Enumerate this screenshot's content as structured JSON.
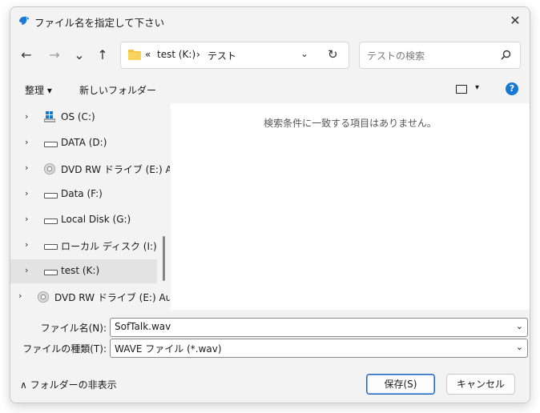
{
  "window": {
    "title": "ファイル名を指定して下さい",
    "close": "✕"
  },
  "nav": {
    "back": "←",
    "forward": "→",
    "recent": "⌄",
    "up": "↑"
  },
  "address": {
    "overflow": "«",
    "crumbs": [
      "test (K:)",
      "テスト"
    ],
    "sep": "›"
  },
  "search": {
    "placeholder": "テストの検索"
  },
  "toolbar": {
    "organize": "整理 ▾",
    "new_folder": "新しいフォルダー",
    "view_chevron": "▾",
    "help": "?"
  },
  "tree": [
    {
      "label": "OS (C:)",
      "icon": "windows-drive-icon"
    },
    {
      "label": "DATA (D:)",
      "icon": "drive-icon"
    },
    {
      "label": "DVD RW ドライブ (E:) Audio CD",
      "icon": "disc-icon"
    },
    {
      "label": "Data (F:)",
      "icon": "drive-icon"
    },
    {
      "label": "Local Disk (G:)",
      "icon": "drive-icon"
    },
    {
      "label": "ローカル ディスク (I:)",
      "icon": "drive-icon"
    },
    {
      "label": "test (K:)",
      "icon": "drive-icon",
      "selected": true
    },
    {
      "label": "DVD RW ドライブ (E:) Audio CD",
      "icon": "disc-icon"
    }
  ],
  "content": {
    "empty_message": "検索条件に一致する項目はありません。"
  },
  "form": {
    "filename_label": "ファイル名(N):",
    "filename_value": "SofTalk.wav",
    "type_label": "ファイルの種類(T):",
    "type_value": "WAVE ファイル (*.wav)"
  },
  "footer": {
    "hide_folders": "∧ フォルダーの非表示",
    "save": "保存(S)",
    "cancel": "キャンセル"
  }
}
